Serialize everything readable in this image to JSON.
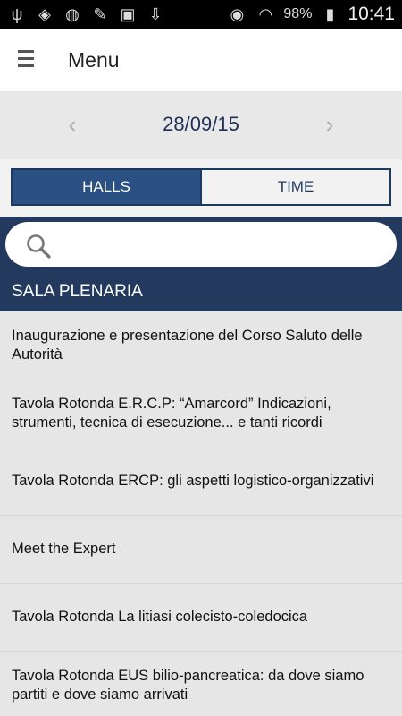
{
  "status_bar": {
    "left_icons": [
      "usb-icon",
      "dropbox-icon",
      "globe-icon",
      "pencil-icon",
      "briefcase-icon",
      "download-icon"
    ],
    "right_icons": [
      "eye-icon",
      "wifi-icon"
    ],
    "battery": "98%",
    "time": "10:41"
  },
  "app_bar": {
    "title": "Menu"
  },
  "date_nav": {
    "date": "28/09/15",
    "prev": "‹",
    "next": "›"
  },
  "tabs": {
    "halls": "HALLS",
    "time": "TIME",
    "selected": "HALLS"
  },
  "search": {
    "placeholder": "",
    "value": ""
  },
  "section": {
    "title": "SALA PLENARIA"
  },
  "items": [
    {
      "title": "Inaugurazione e presentazione del Corso Saluto delle Autorità"
    },
    {
      "title": "Tavola Rotonda E.R.C.P: “Amarcord” Indicazioni, strumenti, tecnica di esecuzione... e tanti ricordi"
    },
    {
      "title": "Tavola Rotonda ERCP: gli aspetti logistico-organizzativi"
    },
    {
      "title": "Meet the Expert"
    },
    {
      "title": "Tavola Rotonda La litiasi colecisto-coledocica"
    },
    {
      "title": "Tavola Rotonda EUS bilio-pancreatica: da dove siamo partiti e dove siamo arrivati"
    }
  ],
  "colors": {
    "navy": "#233a5e",
    "tab_active": "#2b5083",
    "date_text": "#1f2f55"
  }
}
